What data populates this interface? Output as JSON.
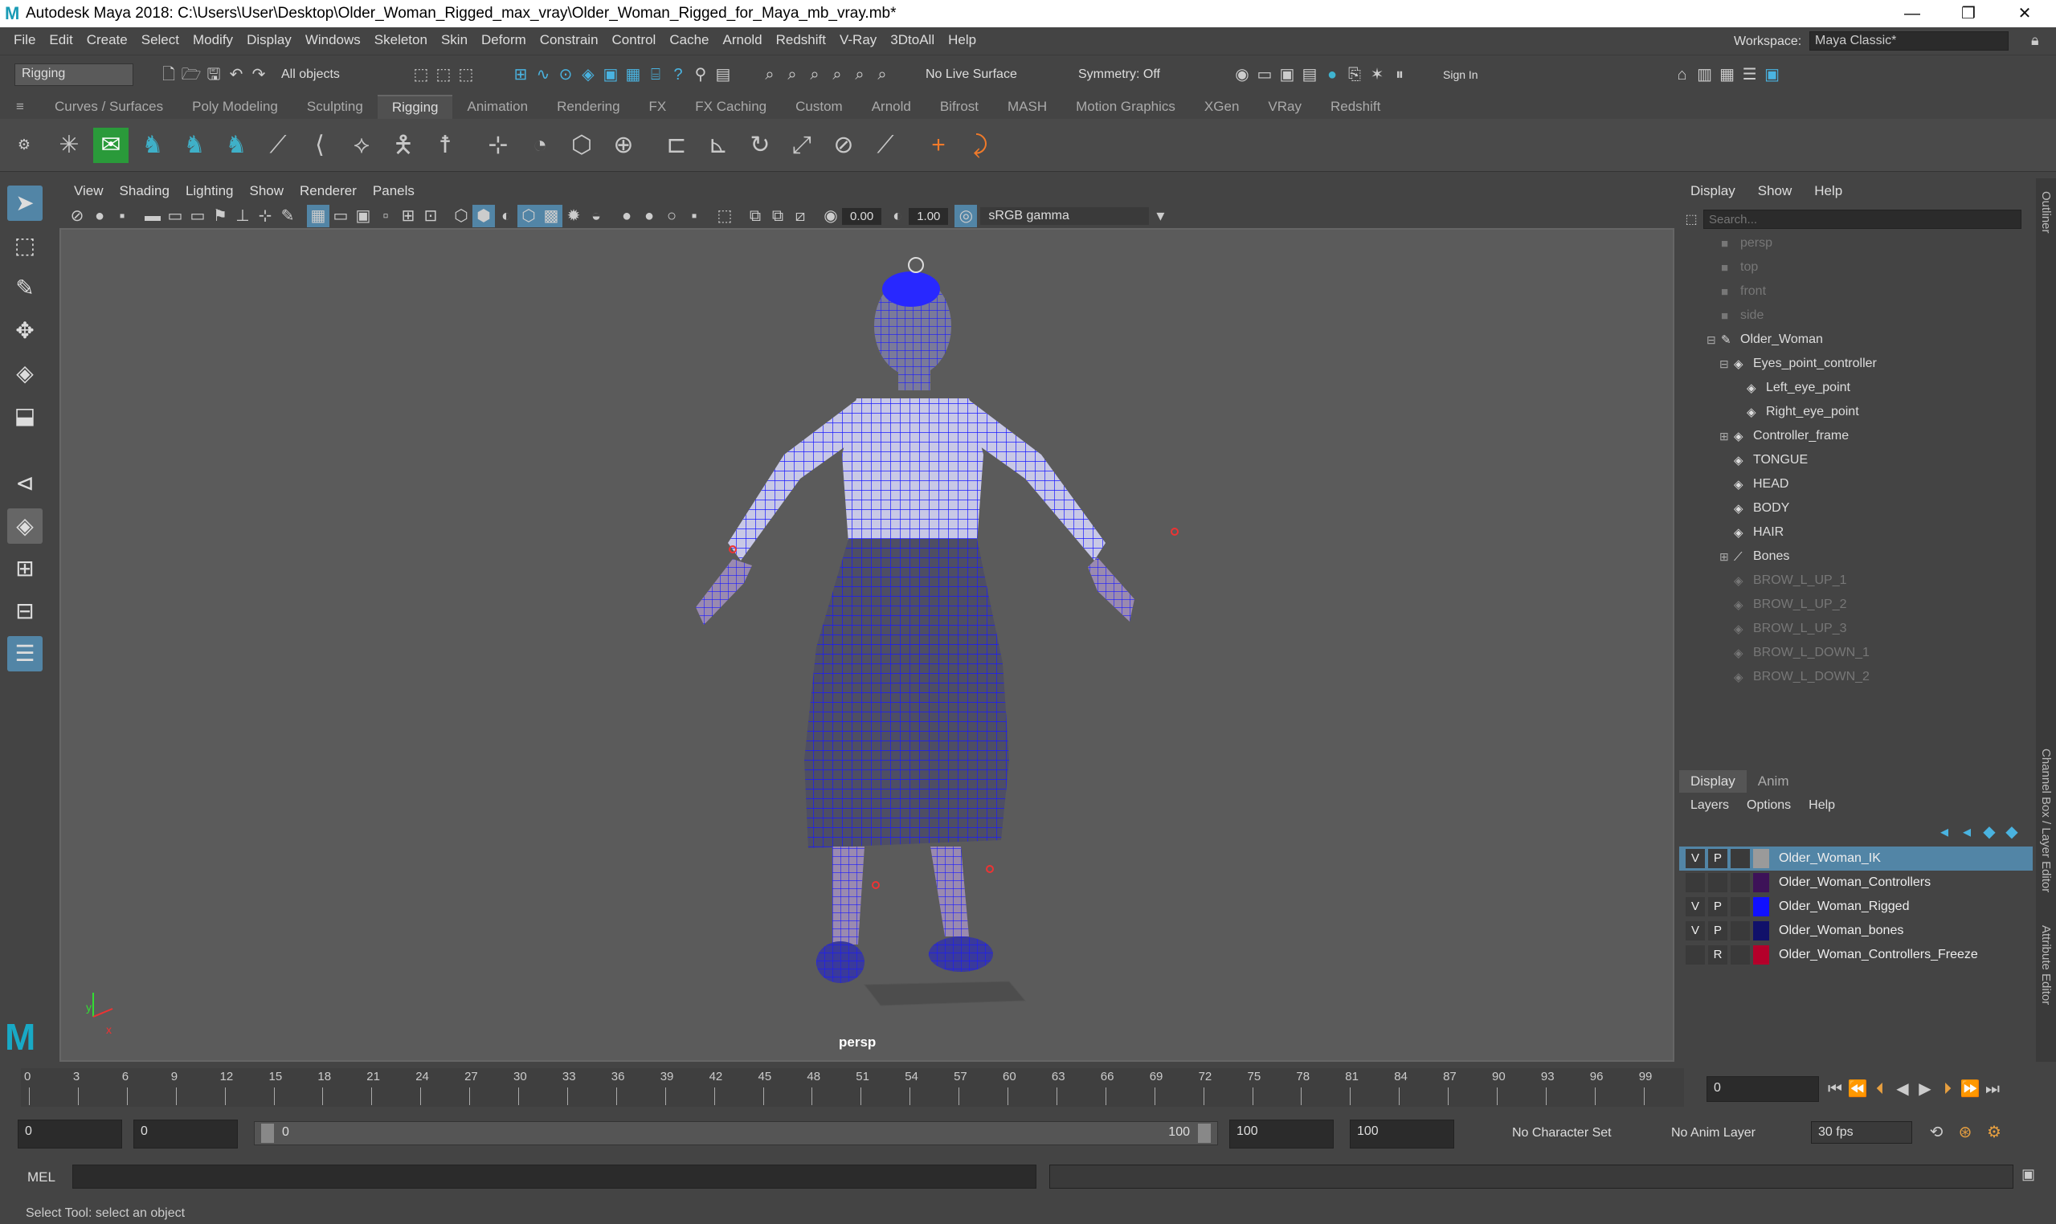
{
  "title": {
    "text": "Autodesk Maya 2018: C:\\Users\\User\\Desktop\\Older_Woman_Rigged_max_vray\\Older_Woman_Rigged_for_Maya_mb_vray.mb*"
  },
  "window_controls": {
    "minimize": "—",
    "maximize": "❐",
    "close": "✕"
  },
  "menubar": [
    "File",
    "Edit",
    "Create",
    "Select",
    "Modify",
    "Display",
    "Windows",
    "Skeleton",
    "Skin",
    "Deform",
    "Constrain",
    "Control",
    "Cache",
    "Arnold",
    "Redshift",
    "V-Ray",
    "3DtoAll",
    "Help"
  ],
  "workspace": {
    "label": "Workspace:",
    "value": "Maya Classic*"
  },
  "statusline": {
    "mode": "Rigging",
    "selection": "All objects",
    "live_surface": "No Live Surface",
    "symmetry": "Symmetry: Off",
    "sign_in": "Sign In"
  },
  "shelf_tabs": [
    "Curves / Surfaces",
    "Poly Modeling",
    "Sculpting",
    "Rigging",
    "Animation",
    "Rendering",
    "FX",
    "FX Caching",
    "Custom",
    "Arnold",
    "Bifrost",
    "MASH",
    "Motion Graphics",
    "XGen",
    "VRay",
    "Redshift"
  ],
  "shelf_active": "Rigging",
  "viewport": {
    "menu": [
      "View",
      "Shading",
      "Lighting",
      "Show",
      "Renderer",
      "Panels"
    ],
    "exposure": "0.00",
    "gamma": "1.00",
    "colorspace": "sRGB gamma",
    "camera_label": "persp",
    "axis_y": "y",
    "axis_x": "x"
  },
  "outliner": {
    "menu": [
      "Display",
      "Show",
      "Help"
    ],
    "search_placeholder": "Search...",
    "items": [
      {
        "label": "persp",
        "dim": true,
        "indent": 0,
        "icon": "camera-icon"
      },
      {
        "label": "top",
        "dim": true,
        "indent": 0,
        "icon": "camera-icon"
      },
      {
        "label": "front",
        "dim": true,
        "indent": 0,
        "icon": "camera-icon"
      },
      {
        "label": "side",
        "dim": true,
        "indent": 0,
        "icon": "camera-icon"
      },
      {
        "label": "Older_Woman",
        "dim": false,
        "indent": 0,
        "icon": "group-icon",
        "expand": "⊟"
      },
      {
        "label": "Eyes_point_controller",
        "dim": false,
        "indent": 1,
        "icon": "transform-icon",
        "expand": "⊟"
      },
      {
        "label": "Left_eye_point",
        "dim": false,
        "indent": 2,
        "icon": "transform-icon"
      },
      {
        "label": "Right_eye_point",
        "dim": false,
        "indent": 2,
        "icon": "transform-icon"
      },
      {
        "label": "Controller_frame",
        "dim": false,
        "indent": 1,
        "icon": "transform-icon",
        "expand": "⊞"
      },
      {
        "label": "TONGUE",
        "dim": false,
        "indent": 1,
        "icon": "transform-icon"
      },
      {
        "label": "HEAD",
        "dim": false,
        "indent": 1,
        "icon": "transform-icon"
      },
      {
        "label": "BODY",
        "dim": false,
        "indent": 1,
        "icon": "transform-icon"
      },
      {
        "label": "HAIR",
        "dim": false,
        "indent": 1,
        "icon": "transform-icon"
      },
      {
        "label": "Bones",
        "dim": false,
        "indent": 1,
        "icon": "joint-icon",
        "expand": "⊞"
      },
      {
        "label": "BROW_L_UP_1",
        "dim": true,
        "indent": 1,
        "icon": "transform-icon"
      },
      {
        "label": "BROW_L_UP_2",
        "dim": true,
        "indent": 1,
        "icon": "transform-icon"
      },
      {
        "label": "BROW_L_UP_3",
        "dim": true,
        "indent": 1,
        "icon": "transform-icon"
      },
      {
        "label": "BROW_L_DOWN_1",
        "dim": true,
        "indent": 1,
        "icon": "transform-icon"
      },
      {
        "label": "BROW_L_DOWN_2",
        "dim": true,
        "indent": 1,
        "icon": "transform-icon"
      }
    ]
  },
  "layer_editor": {
    "tabs": [
      "Display",
      "Anim"
    ],
    "menu": [
      "Layers",
      "Options",
      "Help"
    ],
    "layers": [
      {
        "v": "V",
        "p": "P",
        "color": "#9a9a9a",
        "name": "Older_Woman_IK",
        "selected": true
      },
      {
        "v": "",
        "p": "",
        "color": "#3d1258",
        "name": "Older_Woman_Controllers",
        "selected": false
      },
      {
        "v": "V",
        "p": "P",
        "color": "#1010ff",
        "name": "Older_Woman_Rigged",
        "selected": false
      },
      {
        "v": "V",
        "p": "P",
        "color": "#11116a",
        "name": "Older_Woman_bones",
        "selected": false
      },
      {
        "v": "",
        "p": "R",
        "color": "#b4002a",
        "name": "Older_Woman_Controllers_Freeze",
        "selected": false
      }
    ]
  },
  "timeline": {
    "ticks": [
      "0",
      "3",
      "6",
      "9",
      "12",
      "15",
      "18",
      "21",
      "24",
      "27",
      "30",
      "33",
      "36",
      "39",
      "42",
      "45",
      "48",
      "51",
      "54",
      "57",
      "60",
      "63",
      "66",
      "69",
      "72",
      "75",
      "78",
      "81",
      "84",
      "87",
      "90",
      "93",
      "96",
      "99"
    ],
    "current_frame": "0"
  },
  "range": {
    "start": "0",
    "anim_start": "0",
    "slider_start": "0",
    "slider_end": "100",
    "anim_end": "100",
    "end": "100",
    "character_set": "No Character Set",
    "anim_layer": "No Anim Layer",
    "fps": "30 fps"
  },
  "command_line": {
    "label": "MEL"
  },
  "help_line": {
    "text": "Select Tool: select an object"
  },
  "side_tabs": {
    "outliner": "Outliner",
    "channel_box": "Channel Box / Layer Editor",
    "attribute_editor": "Attribute Editor"
  },
  "colors": {
    "accent": "#5285a6",
    "wire": "#1a1aff"
  }
}
